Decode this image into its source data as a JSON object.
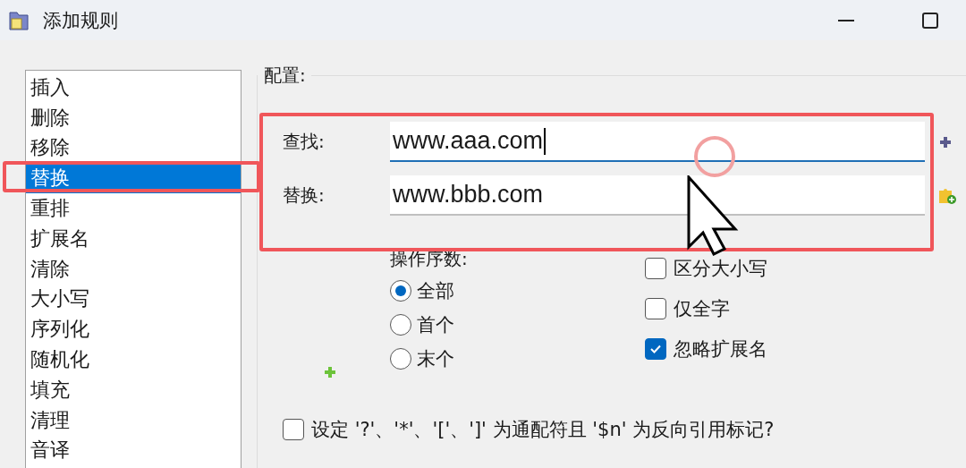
{
  "window": {
    "title": "添加规则"
  },
  "rule_list": {
    "items": [
      {
        "label": "插入",
        "selected": false
      },
      {
        "label": "删除",
        "selected": false
      },
      {
        "label": "移除",
        "selected": false
      },
      {
        "label": "替换",
        "selected": true
      },
      {
        "label": "重排",
        "selected": false
      },
      {
        "label": "扩展名",
        "selected": false
      },
      {
        "label": "清除",
        "selected": false
      },
      {
        "label": "大小写",
        "selected": false
      },
      {
        "label": "序列化",
        "selected": false
      },
      {
        "label": "随机化",
        "selected": false
      },
      {
        "label": "填充",
        "selected": false
      },
      {
        "label": "清理",
        "selected": false
      },
      {
        "label": "音译",
        "selected": false
      }
    ]
  },
  "config": {
    "title": "配置:",
    "fields": [
      {
        "label": "查找:",
        "value": "www.aaa.com",
        "focused": true
      },
      {
        "label": "替换:",
        "value": "www.bbb.com",
        "focused": false
      }
    ],
    "occurrence": {
      "title": "操作序数:",
      "options": [
        {
          "label": "全部",
          "selected": true
        },
        {
          "label": "首个",
          "selected": false
        },
        {
          "label": "末个",
          "selected": false
        }
      ]
    },
    "options": [
      {
        "label": "区分大小写",
        "checked": false
      },
      {
        "label": "仅全字",
        "checked": false
      },
      {
        "label": "忽略扩展名",
        "checked": true
      }
    ],
    "wildcard": {
      "label": "设定 '?'、'*'、'['、']' 为通配符且 '$n' 为反向引用标记?",
      "checked": false
    }
  }
}
